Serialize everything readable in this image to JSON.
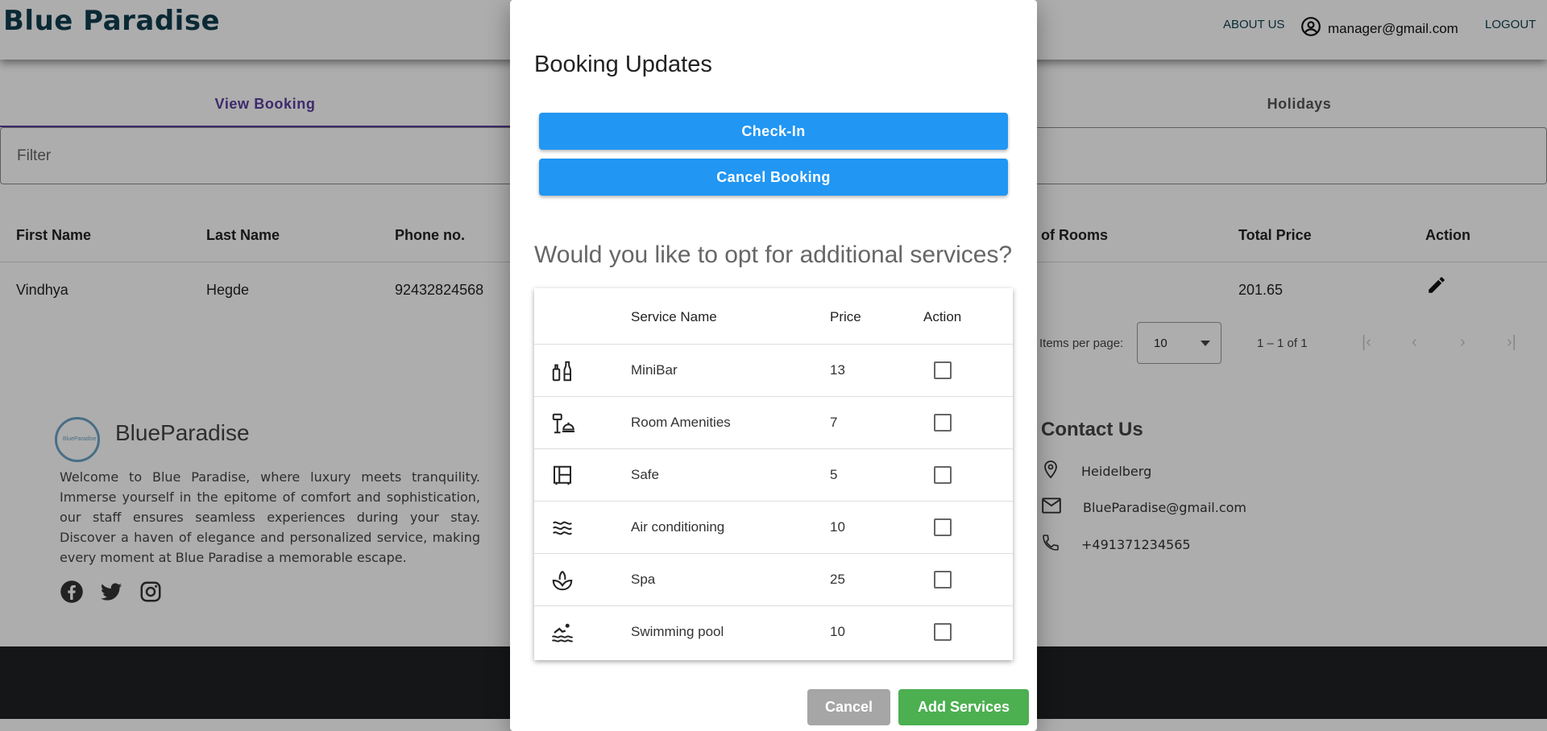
{
  "header": {
    "brand": "Blue Paradise",
    "about_label": "ABOUT US",
    "user_email": "manager@gmail.com",
    "logout_label": "LOGOUT"
  },
  "tabs": [
    {
      "label": "View Booking",
      "active": true
    },
    {
      "label": "Holidays",
      "active": false
    }
  ],
  "filter": {
    "label": "Filter"
  },
  "bookings_table": {
    "headers": [
      "First Name",
      "Last Name",
      "Phone no.",
      "of Rooms",
      "Total Price",
      "Action"
    ],
    "rows": [
      {
        "first_name": "Vindhya",
        "last_name": "Hegde",
        "phone": "92432824568",
        "total_price": "201.65",
        "action_icon": "edit-icon"
      }
    ]
  },
  "paginator": {
    "items_per_page_label": "Items per page:",
    "page_size": "10",
    "range_label": "1 – 1 of 1",
    "first": "|‹",
    "prev": "‹",
    "next": "›",
    "last": "›|"
  },
  "footer": {
    "logo_text": "BlueParadise",
    "name": "BlueParadise",
    "description": "Welcome to Blue Paradise, where luxury meets tranquility. Immerse yourself in the epitome of comfort and sophistication, our staff ensures seamless experiences during your stay. Discover a haven of elegance and personalized service, making every moment at Blue Paradise a memorable escape.",
    "social": [
      "facebook-icon",
      "twitter-icon",
      "instagram-icon"
    ],
    "contact_title": "Contact Us",
    "contact": {
      "location": "Heidelberg",
      "email": "BlueParadise@gmail.com",
      "phone": "+491371234565"
    }
  },
  "modal": {
    "title": "Booking Updates",
    "checkin_label": "Check-In",
    "cancel_booking_label": "Cancel Booking",
    "question": "Would you like to opt for additional services?",
    "services_headers": {
      "name": "Service Name",
      "price": "Price",
      "action": "Action"
    },
    "services": [
      {
        "icon": "minibar-icon",
        "name": "MiniBar",
        "price": "13",
        "checked": false
      },
      {
        "icon": "room-amenities-icon",
        "name": "Room Amenities",
        "price": "7",
        "checked": false
      },
      {
        "icon": "safe-icon",
        "name": "Safe",
        "price": "5",
        "checked": false
      },
      {
        "icon": "air-conditioning-icon",
        "name": "Air conditioning",
        "price": "10",
        "checked": false
      },
      {
        "icon": "spa-icon",
        "name": "Spa",
        "price": "25",
        "checked": false
      },
      {
        "icon": "swimming-pool-icon",
        "name": "Swimming pool",
        "price": "10",
        "checked": false
      }
    ],
    "cancel_label": "Cancel",
    "add_services_label": "Add Services"
  },
  "colors": {
    "brand": "#0f3d4f",
    "tab_active": "#5a3fa0",
    "primary_button": "#2196f3",
    "success_button": "#4caf50",
    "neutral_button": "#a6a6a6"
  }
}
